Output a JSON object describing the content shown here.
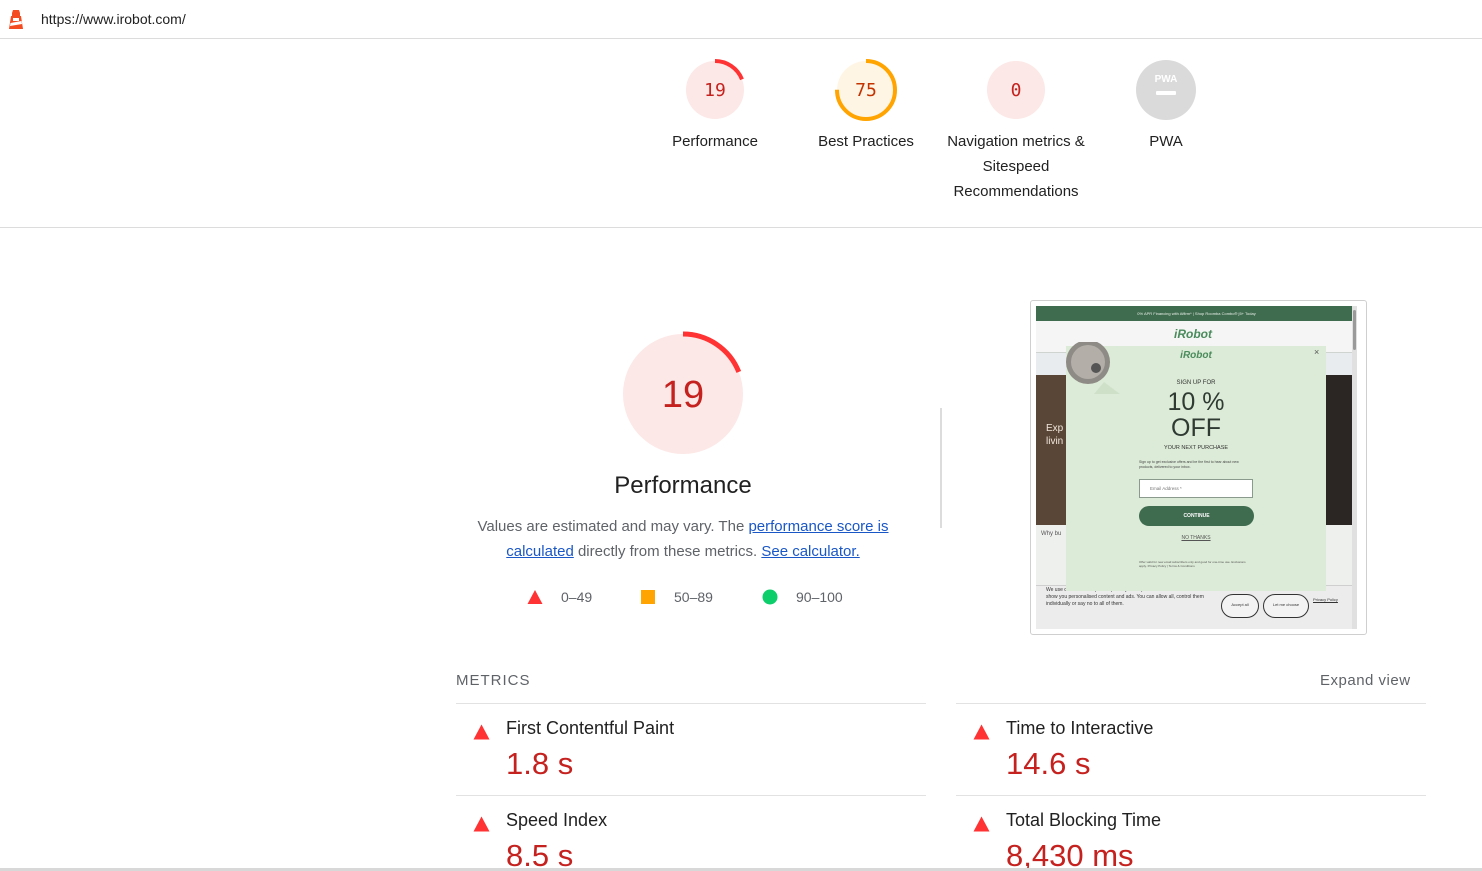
{
  "url": "https://www.irobot.com/",
  "colors": {
    "fail": "#c5221f",
    "fail_shape": "#ff3333",
    "average": "#ffa400",
    "pass": "#0cce6b"
  },
  "categories": [
    {
      "score": "19",
      "label": "Performance",
      "fraction": 0.19,
      "ring": "#ff3333",
      "fill": "#fce8e6",
      "text": "#c5221f"
    },
    {
      "score": "75",
      "label": "Best Practices",
      "fraction": 0.75,
      "ring": "#ffa400",
      "fill": "#fff5e5",
      "text": "#c33300"
    },
    {
      "score": "0",
      "label": "Navigation metrics & Sitespeed Recommendations",
      "fraction": 0.0,
      "ring": "#ff3333",
      "fill": "#fce8e6",
      "text": "#c5221f"
    },
    {
      "score": "",
      "label": "PWA",
      "badge_text": "PWA"
    }
  ],
  "performance": {
    "score": "19",
    "fraction": 0.19,
    "title": "Performance",
    "desc_start": "Values are estimated and may vary. The ",
    "desc_link1": "performance score is calculated",
    "desc_mid": " directly from these metrics. ",
    "desc_link2": "See calculator."
  },
  "legend": [
    {
      "shape": "triangle-icon",
      "range": "0–49"
    },
    {
      "shape": "square-icon",
      "range": "50–89"
    },
    {
      "shape": "circle-icon",
      "range": "90–100"
    }
  ],
  "screenshot": {
    "banner": "0% APR Financing with Affirm* | Shop Roomba Combo® j5+ Today",
    "site_logo": "iRobot",
    "hero_text": "Exp\nlivin",
    "why_text": "Why bu",
    "modal": {
      "logo": "iRobot",
      "signup": "SIGN UP FOR",
      "pct": "10 %",
      "off": "OFF",
      "next": "YOUR NEXT PURCHASE",
      "small": "Sign up to get exclusive offers and be the first to hear about new products, delivered to your inbox.",
      "email_placeholder": "Email Address *",
      "continue": "CONTINUE",
      "no_thanks": "NO THANKS",
      "fine": "Offer valid for new email subscribers only and good for one-time use. Exclusions apply. Privacy Policy | Terms & Conditions"
    },
    "cookie_text": "We use cookies to help us improve your experience on our website and to show you personalised content and ads. You can allow all, control them individually or say no to all of them.",
    "accept": "Accept all",
    "let_me": "Let me choose",
    "privacy": "Privacy Policy"
  },
  "metrics_heading": "METRICS",
  "expand_view": "Expand view",
  "metrics": [
    {
      "name": "First Contentful Paint",
      "value": "1.8 s"
    },
    {
      "name": "Time to Interactive",
      "value": "14.6 s"
    },
    {
      "name": "Speed Index",
      "value": "8.5 s"
    },
    {
      "name": "Total Blocking Time",
      "value": "8,430 ms"
    }
  ]
}
